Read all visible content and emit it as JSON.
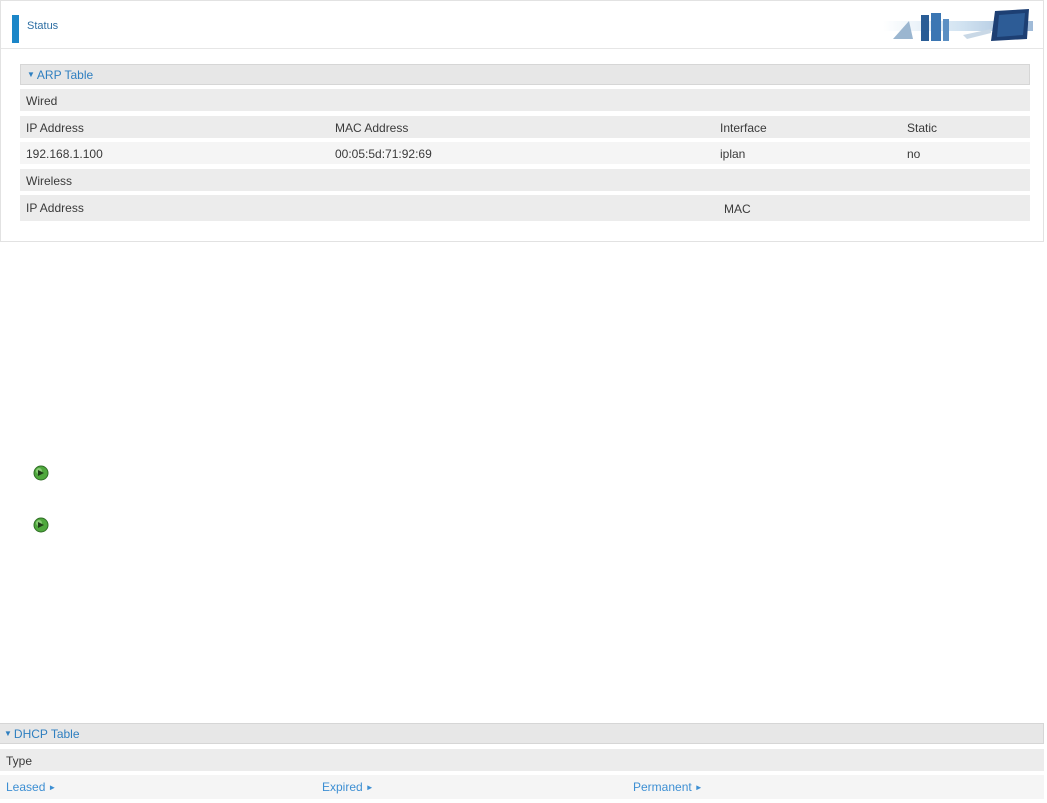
{
  "status_panel": {
    "title": "Status",
    "arp_table": {
      "title": "ARP Table",
      "wired_label": "Wired",
      "columns": [
        "IP Address",
        "MAC Address",
        "Interface",
        "Static"
      ],
      "rows": [
        {
          "ip": "192.168.1.100",
          "mac": "00:05:5d:71:92:69",
          "interface": "iplan",
          "static": "no"
        }
      ],
      "wireless_label": "Wireless",
      "wireless_columns": [
        "IP Address",
        "MAC"
      ]
    }
  },
  "dhcp_table": {
    "title": "DHCP Table",
    "type_label": "Type",
    "links": [
      "Leased",
      "Expired",
      "Permanent"
    ]
  },
  "colors": {
    "accent": "#1b86c8",
    "link": "#3d8fd3",
    "row_gray": "#ececec",
    "bullet": "#4fa83d"
  },
  "icons": {
    "section_toggle": "triangle-down",
    "link_arrow": "triangle-right",
    "bullet": "green-arrow-bullet"
  }
}
